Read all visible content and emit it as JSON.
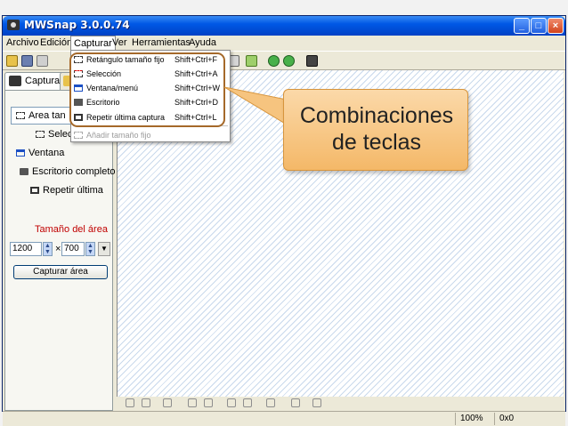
{
  "window": {
    "title": "MWSnap 3.0.0.74"
  },
  "menu": {
    "items": [
      "Archivo",
      "Edición",
      "Capturar",
      "Ver",
      "Herramientas",
      "Ayuda"
    ],
    "active": "Capturar"
  },
  "capturar_menu": {
    "items": [
      {
        "label": "Retángulo tamaño fijo",
        "shortcut": "Shift+Ctrl+F",
        "icon": "fixed-rectangle-icon"
      },
      {
        "label": "Selección",
        "shortcut": "Shift+Ctrl+A",
        "icon": "selection-icon"
      },
      {
        "label": "Ventana/menú",
        "shortcut": "Shift+Ctrl+W",
        "icon": "window-icon"
      },
      {
        "label": "Escritorio",
        "shortcut": "Shift+Ctrl+D",
        "icon": "desktop-icon"
      },
      {
        "label": "Repetir última captura",
        "shortcut": "Shift+Ctrl+L",
        "icon": "repeat-capture-icon"
      }
    ],
    "disabled_item": {
      "label": "Añadir tamaño fijo"
    }
  },
  "left_panel": {
    "tab": "Captura",
    "items": [
      "Area tan",
      "Selec",
      "Ventana",
      "Escritorio completo",
      "Repetir última"
    ],
    "area_size_label": "Tamaño del área",
    "width": "1200",
    "times": "×",
    "height": "700",
    "capture_button": "Capturar área"
  },
  "status": {
    "zoom": "100%",
    "coords": "0x0"
  },
  "callout": {
    "line1": "Combinaciones",
    "line2": "de teclas"
  },
  "colors": {
    "callout_fill": "#f4b868",
    "highlight_border": "#a5692a",
    "titlebar": "#0058e6"
  }
}
